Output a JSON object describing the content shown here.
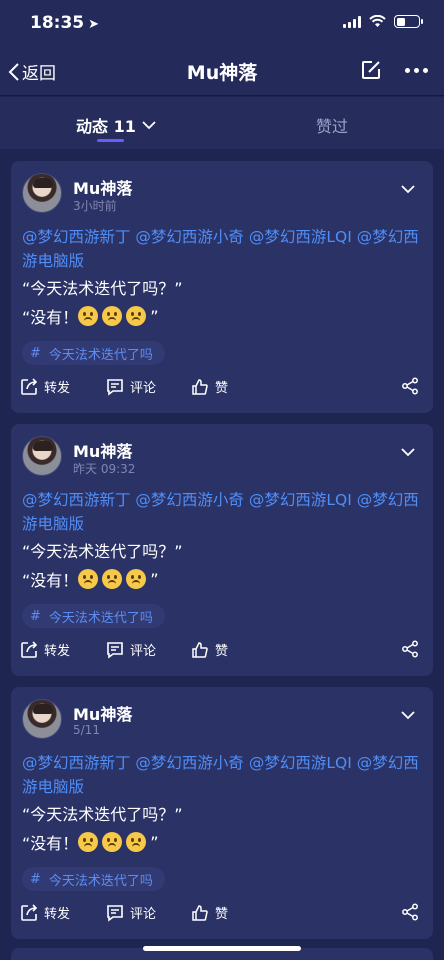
{
  "status": {
    "time": "18:35"
  },
  "nav": {
    "back_label": "返回",
    "title": "Mu神落"
  },
  "tabs": {
    "active_label": "动态 11",
    "inactive_label": "赞过"
  },
  "posts": [
    {
      "username": "Mu神落",
      "time": "3小时前",
      "mentions": "@梦幻西游新丁 @梦幻西游小奇 @梦幻西游LQI @梦幻西游电脑版",
      "line1": "“今天法术迭代了吗？”",
      "line2": "“没有！",
      "line2_end": "”",
      "topic": "今天法术迭代了吗",
      "actions": {
        "share": "转发",
        "comment": "评论",
        "like": "赞"
      }
    },
    {
      "username": "Mu神落",
      "time": "昨天 09:32",
      "mentions": "@梦幻西游新丁 @梦幻西游小奇 @梦幻西游LQI @梦幻西游电脑版",
      "line1": "“今天法术迭代了吗？”",
      "line2": "“没有！",
      "line2_end": "”",
      "topic": "今天法术迭代了吗",
      "actions": {
        "share": "转发",
        "comment": "评论",
        "like": "赞"
      }
    },
    {
      "username": "Mu神落",
      "time": "5/11",
      "mentions": "@梦幻西游新丁 @梦幻西游小奇 @梦幻西游LQI @梦幻西游电脑版",
      "line1": "“今天法术迭代了吗？”",
      "line2": "“没有！",
      "line2_end": "”",
      "topic": "今天法术迭代了吗",
      "actions": {
        "share": "转发",
        "comment": "评论",
        "like": "赞"
      }
    }
  ],
  "colors": {
    "background": "#1e2550",
    "card": "#2b3266",
    "link": "#4f8ef7",
    "accent": "#6b5cff"
  }
}
